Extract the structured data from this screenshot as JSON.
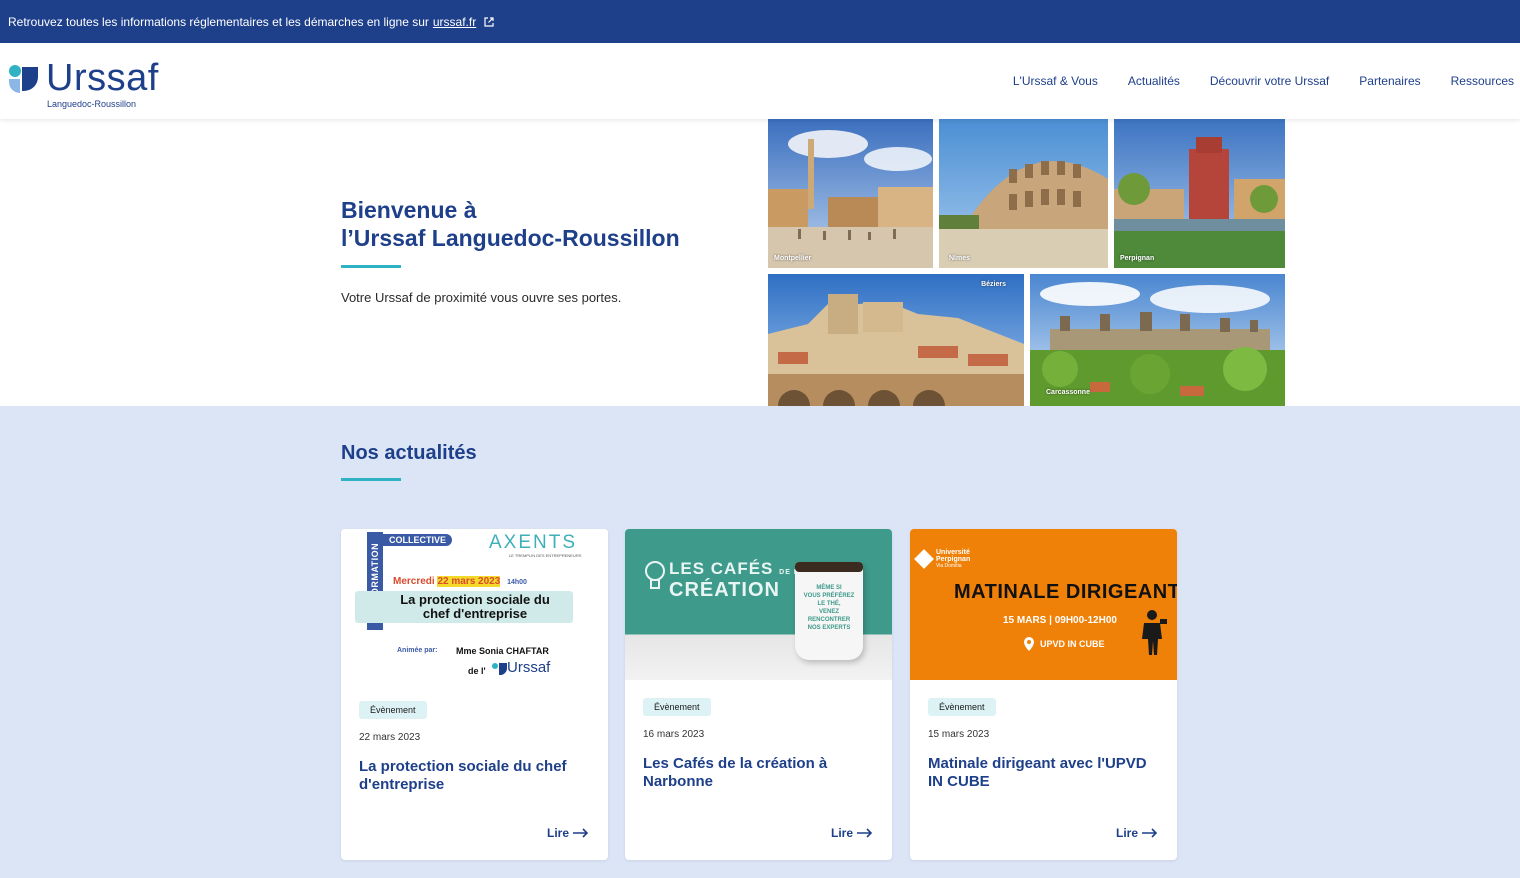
{
  "topbar": {
    "text": "Retrouvez toutes les informations réglementaires et les démarches en ligne sur",
    "link": "urssaf.fr"
  },
  "header": {
    "logo_word": "Urssaf",
    "logo_sub": "Languedoc-Roussillon",
    "nav": [
      "L'Urssaf & Vous",
      "Actualités",
      "Découvrir votre Urssaf",
      "Partenaires",
      "Ressources"
    ]
  },
  "hero": {
    "title_line1": "Bienvenue à",
    "title_line2": "l’Urssaf Languedoc-Roussillon",
    "subtitle": "Votre Urssaf de proximité vous ouvre ses portes.",
    "cities": [
      "Montpellier",
      "Nîmes",
      "Perpignan",
      "Béziers",
      "Carcassonne"
    ]
  },
  "news": {
    "title": "Nos actualités",
    "read_label": "Lire",
    "cards": [
      {
        "badge": "Évènement",
        "date": "22 mars 2023",
        "title": "La protection sociale du chef d'entreprise",
        "poster": {
          "side": "INFORMATION",
          "tag": "COLLECTIVE",
          "brand": "AXENTS",
          "brand_sub": "LE TREMPLIN DES ENTREPRENEURS",
          "when_day": "Mercredi",
          "when_date": "22 mars 2023",
          "when_time": "14h00",
          "headline_1": "La protection sociale du",
          "headline_2": "chef d'entreprise",
          "host_label": "Animée par:",
          "host_name": "Mme Sonia CHAFTAR",
          "host_of": "de l'",
          "host_org": "Urssaf"
        }
      },
      {
        "badge": "Évènement",
        "date": "16 mars 2023",
        "title": "Les Cafés de la création à Narbonne",
        "poster": {
          "line1": "LES CAFÉS",
          "line1_small": "DE LA",
          "line2": "CRÉATION",
          "cup_lines": [
            "MÊME SI",
            "VOUS PRÉFÉREZ",
            "LE THÉ,",
            "VENEZ",
            "RENCONTRER",
            "NOS EXPERTS"
          ]
        }
      },
      {
        "badge": "Évènement",
        "date": "15 mars 2023",
        "title": "Matinale dirigeant avec l'UPVD IN CUBE",
        "poster": {
          "uni_1": "Université",
          "uni_2": "Perpignan",
          "uni_3": "Via Domitia",
          "headline": "MATINALE DIRIGEANT",
          "when": "15 MARS | 09H00-12H00",
          "where": "UPVD IN CUBE"
        }
      }
    ]
  },
  "colors": {
    "brand_blue": "#1e3f8a",
    "accent_teal": "#2fb3c4",
    "news_bg": "#dbe5f6",
    "orange": "#ef8109",
    "green_poster": "#3e9a8b"
  }
}
